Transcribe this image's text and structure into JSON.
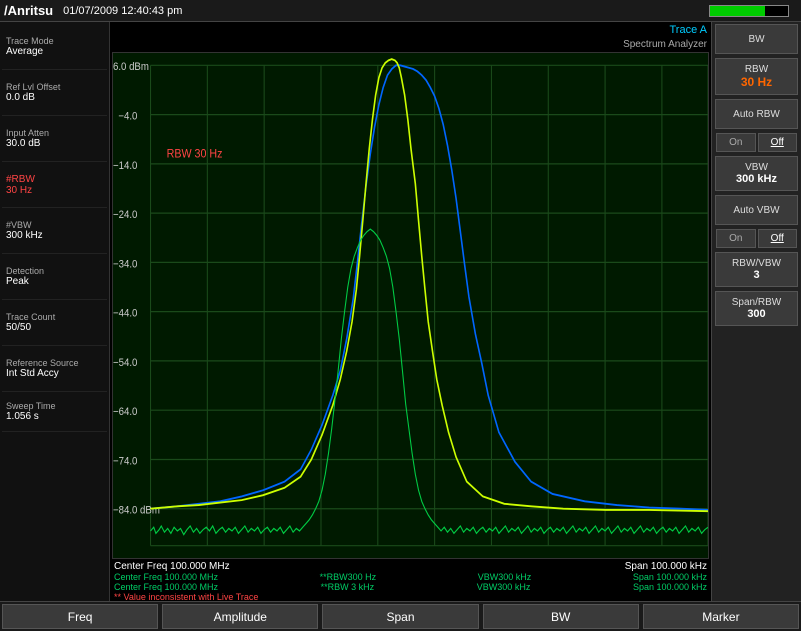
{
  "topbar": {
    "logo": "/Anritsu",
    "datetime": "01/07/2009  12:40:43 pm"
  },
  "left_sidebar": {
    "items": [
      {
        "title": "Trace Mode",
        "value": "Average"
      },
      {
        "title": "Ref Lvl Offset",
        "value": "0.0 dB"
      },
      {
        "title": "Input Atten",
        "value": "30.0 dB"
      },
      {
        "title": "#RBW",
        "value": "30 Hz",
        "red": true
      },
      {
        "title": "#VBW",
        "value": "300 kHz"
      },
      {
        "title": "Detection",
        "value": "Peak"
      },
      {
        "title": "Trace Count",
        "value": "50/50"
      },
      {
        "title": "Reference Source",
        "value": "Int Std Accy"
      }
    ],
    "sweep_time_title": "Sweep Time",
    "sweep_time_value": "1.056 s"
  },
  "chart": {
    "trace_label": "Trace A",
    "analyzer_label": "Spectrum Analyzer",
    "rbw_label": "RBW  30 Hz",
    "y_labels": [
      "6.0 dBm",
      "-4.0",
      "-14.0",
      "-24.0",
      "-34.0",
      "-44.0",
      "-54.0",
      "-64.0",
      "-74.0",
      "-84.0 dBm"
    ],
    "bottom": {
      "line1_left": "Center Freq 100.000 MHz",
      "line1_right": "Span 100.000 kHz",
      "line2_left": "Center Freq 100.000 MHz",
      "line2_mid": "**RBW300 Hz",
      "line2_mid2": "VBW300 kHz",
      "line2_right": "Span 100.000 kHz",
      "line3_left": "Center Freq 100.000 MHz",
      "line3_mid": "**RBW  3 kHz",
      "line3_mid2": "VBW300 kHz",
      "line3_right": "Span 100.000 kHz",
      "warning": "** Value inconsistent with Live Trace"
    }
  },
  "right_menu": {
    "buttons": [
      {
        "label": "BW",
        "value": ""
      },
      {
        "label": "RBW",
        "value": ""
      },
      {
        "label": "rbw_value",
        "value": "30 Hz",
        "red": true
      },
      {
        "label": "Auto RBW",
        "value": ""
      },
      {
        "label": "On",
        "off": "Off"
      },
      {
        "label": "VBW",
        "value": ""
      },
      {
        "label": "vbw_value",
        "value": "300 kHz"
      },
      {
        "label": "Auto VBW",
        "value": ""
      },
      {
        "label": "On2",
        "off2": "Off"
      },
      {
        "label": "RBW/VBW",
        "value": ""
      },
      {
        "label": "rbwvbw_value",
        "value": "3"
      },
      {
        "label": "Span/RBW",
        "value": ""
      },
      {
        "label": "spanrbw_value",
        "value": "300"
      }
    ]
  },
  "bottom_nav": {
    "items": [
      "Freq",
      "Amplitude",
      "Span",
      "BW",
      "Marker"
    ]
  }
}
